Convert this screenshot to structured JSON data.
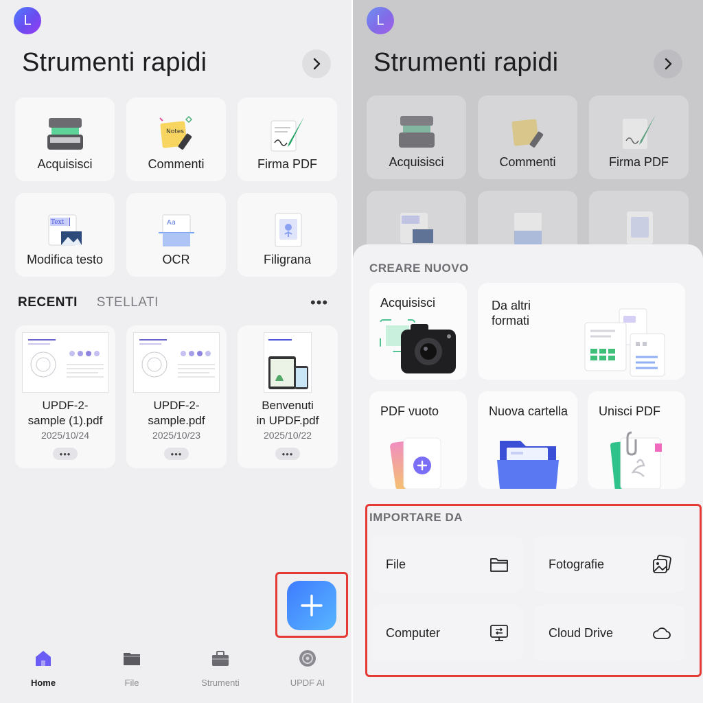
{
  "left": {
    "avatar_letter": "L",
    "title": "Strumenti rapidi",
    "quick_tools": [
      {
        "label": "Acquisisci",
        "icon": "scanner-icon"
      },
      {
        "label": "Commenti",
        "icon": "notes-icon"
      },
      {
        "label": "Firma PDF",
        "icon": "signature-icon"
      },
      {
        "label": "Modifica testo",
        "icon": "edit-text-icon"
      },
      {
        "label": "OCR",
        "icon": "ocr-icon"
      },
      {
        "label": "Filigrana",
        "icon": "watermark-icon"
      }
    ],
    "tabs": {
      "active": "RECENTI",
      "inactive": "STELLATI",
      "more": "•••"
    },
    "recent_files": [
      {
        "name_line1": "UPDF-2-",
        "name_line2": "sample (1).pdf",
        "date": "2025/10/24",
        "more": "•••"
      },
      {
        "name_line1": "UPDF-2-",
        "name_line2": "sample.pdf",
        "date": "2025/10/23",
        "more": "•••"
      },
      {
        "name_line1": "Benvenuti",
        "name_line2": "in UPDF.pdf",
        "date": "2025/10/22",
        "more": "•••"
      }
    ],
    "tabbar": [
      {
        "label": "Home",
        "icon": "home-icon",
        "active": true
      },
      {
        "label": "File",
        "icon": "folder-icon",
        "active": false
      },
      {
        "label": "Strumenti",
        "icon": "toolbox-icon",
        "active": false
      },
      {
        "label": "UPDF AI",
        "icon": "ai-icon",
        "active": false
      }
    ]
  },
  "right": {
    "avatar_letter": "L",
    "title": "Strumenti rapidi",
    "quick_tools": [
      {
        "label": "Acquisisci"
      },
      {
        "label": "Commenti"
      },
      {
        "label": "Firma PDF"
      }
    ],
    "create_section": "CREARE NUOVO",
    "create_cards": {
      "scan": "Acquisisci",
      "other_formats_line1": "Da altri",
      "other_formats_line2": "formati",
      "blank_pdf": "PDF vuoto",
      "new_folder": "Nuova cartella",
      "merge_pdf": "Unisci PDF"
    },
    "import_section": "IMPORTARE DA",
    "import_buttons": [
      {
        "label": "File",
        "icon": "folder-icon"
      },
      {
        "label": "Fotografie",
        "icon": "photos-icon"
      },
      {
        "label": "Computer",
        "icon": "computer-transfer-icon"
      },
      {
        "label": "Cloud Drive",
        "icon": "cloud-icon"
      }
    ]
  },
  "colors": {
    "accent_blue": "#3f7bff",
    "highlight_red": "#e53935",
    "background": "#efeff1"
  }
}
